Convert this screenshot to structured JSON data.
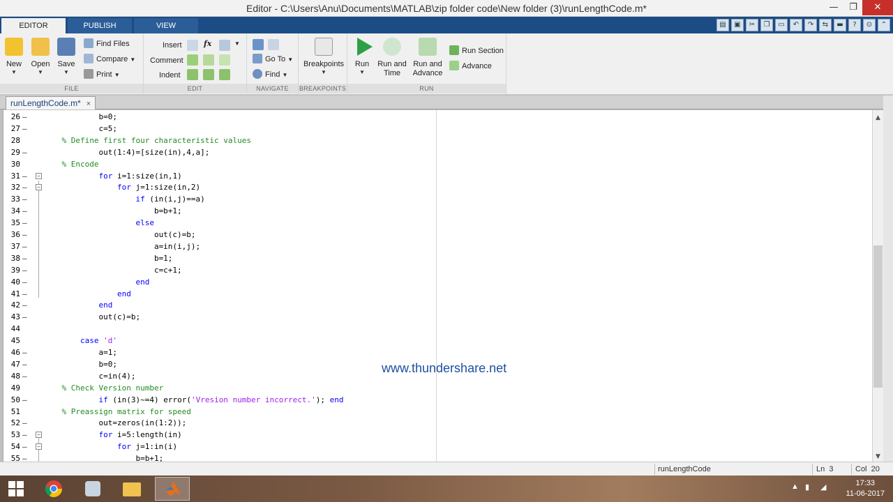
{
  "window": {
    "title": "Editor - C:\\Users\\Anu\\Documents\\MATLAB\\zip folder code\\New folder (3)\\runLengthCode.m*",
    "minimize": "—",
    "restore": "❐",
    "close": "✕"
  },
  "tabs": [
    {
      "label": "EDITOR"
    },
    {
      "label": "PUBLISH"
    },
    {
      "label": "VIEW"
    }
  ],
  "ribbon": {
    "file": {
      "group_label": "FILE",
      "new": "New",
      "open": "Open",
      "save": "Save",
      "find_files": "Find Files",
      "compare": "Compare",
      "print": "Print"
    },
    "edit": {
      "group_label": "EDIT",
      "insert": "Insert",
      "comment": "Comment",
      "indent": "Indent",
      "fx": "fx"
    },
    "navigate": {
      "group_label": "NAVIGATE",
      "goto": "Go To",
      "find": "Find"
    },
    "breakpoints": {
      "group_label": "BREAKPOINTS",
      "breakpoints": "Breakpoints"
    },
    "run": {
      "group_label": "RUN",
      "run": "Run",
      "run_and_time_1": "Run and",
      "run_and_time_2": "Time",
      "run_and_advance_1": "Run and",
      "run_and_advance_2": "Advance",
      "run_section": "Run Section",
      "advance": "Advance"
    },
    "colors": {
      "accent": "#1c4c86",
      "run_green": "#2ea043"
    }
  },
  "file_tab": {
    "name": "runLengthCode.m*",
    "close": "×"
  },
  "code_lines": [
    {
      "num": "26",
      "dash": "—",
      "parts": [
        {
          "t": "            b=0;",
          "c": ""
        }
      ]
    },
    {
      "num": "27",
      "dash": "—",
      "parts": [
        {
          "t": "            c=5;",
          "c": ""
        }
      ]
    },
    {
      "num": "28",
      "dash": "",
      "parts": [
        {
          "t": "    % Define first four characteristic values",
          "c": "cm"
        }
      ]
    },
    {
      "num": "29",
      "dash": "—",
      "parts": [
        {
          "t": "            out(1:4)=[size(in),4,a];",
          "c": ""
        }
      ]
    },
    {
      "num": "30",
      "dash": "",
      "parts": [
        {
          "t": "    % Encode",
          "c": "cm"
        }
      ]
    },
    {
      "num": "31",
      "dash": "—",
      "parts": [
        {
          "t": "            ",
          "c": ""
        },
        {
          "t": "for",
          "c": "kw"
        },
        {
          "t": " i=1:size(in,1)",
          "c": ""
        }
      ]
    },
    {
      "num": "32",
      "dash": "—",
      "parts": [
        {
          "t": "                ",
          "c": ""
        },
        {
          "t": "for",
          "c": "kw"
        },
        {
          "t": " j=1:size(in,2)",
          "c": ""
        }
      ]
    },
    {
      "num": "33",
      "dash": "—",
      "parts": [
        {
          "t": "                    ",
          "c": ""
        },
        {
          "t": "if",
          "c": "kw"
        },
        {
          "t": " (in(i,j)==a)",
          "c": ""
        }
      ]
    },
    {
      "num": "34",
      "dash": "—",
      "parts": [
        {
          "t": "                        b=b+1;",
          "c": ""
        }
      ]
    },
    {
      "num": "35",
      "dash": "—",
      "parts": [
        {
          "t": "                    ",
          "c": ""
        },
        {
          "t": "else",
          "c": "kw"
        }
      ]
    },
    {
      "num": "36",
      "dash": "—",
      "parts": [
        {
          "t": "                        out(c)=b;",
          "c": ""
        }
      ]
    },
    {
      "num": "37",
      "dash": "—",
      "parts": [
        {
          "t": "                        a=in(i,j);",
          "c": ""
        }
      ]
    },
    {
      "num": "38",
      "dash": "—",
      "parts": [
        {
          "t": "                        b=1;",
          "c": ""
        }
      ]
    },
    {
      "num": "39",
      "dash": "—",
      "parts": [
        {
          "t": "                        c=c+1;",
          "c": ""
        }
      ]
    },
    {
      "num": "40",
      "dash": "—",
      "parts": [
        {
          "t": "                    ",
          "c": ""
        },
        {
          "t": "end",
          "c": "kw"
        }
      ]
    },
    {
      "num": "41",
      "dash": "—",
      "parts": [
        {
          "t": "                ",
          "c": ""
        },
        {
          "t": "end",
          "c": "kw"
        }
      ]
    },
    {
      "num": "42",
      "dash": "—",
      "parts": [
        {
          "t": "            ",
          "c": ""
        },
        {
          "t": "end",
          "c": "kw"
        }
      ]
    },
    {
      "num": "43",
      "dash": "—",
      "parts": [
        {
          "t": "            out(c)=b;",
          "c": ""
        }
      ]
    },
    {
      "num": "44",
      "dash": "",
      "parts": [
        {
          "t": "",
          "c": ""
        }
      ]
    },
    {
      "num": "45",
      "dash": "",
      "parts": [
        {
          "t": "        ",
          "c": ""
        },
        {
          "t": "case",
          "c": "kw"
        },
        {
          "t": " ",
          "c": ""
        },
        {
          "t": "'d'",
          "c": "st"
        }
      ]
    },
    {
      "num": "46",
      "dash": "—",
      "parts": [
        {
          "t": "            a=1;",
          "c": ""
        }
      ]
    },
    {
      "num": "47",
      "dash": "—",
      "parts": [
        {
          "t": "            b=0;",
          "c": ""
        }
      ]
    },
    {
      "num": "48",
      "dash": "—",
      "parts": [
        {
          "t": "            c=in(4);",
          "c": ""
        }
      ]
    },
    {
      "num": "49",
      "dash": "",
      "parts": [
        {
          "t": "    % Check Version number",
          "c": "cm"
        }
      ]
    },
    {
      "num": "50",
      "dash": "—",
      "parts": [
        {
          "t": "            ",
          "c": ""
        },
        {
          "t": "if",
          "c": "kw"
        },
        {
          "t": " (in(3)~=4) error(",
          "c": ""
        },
        {
          "t": "'Vresion number incorrect.'",
          "c": "st"
        },
        {
          "t": "); ",
          "c": ""
        },
        {
          "t": "end",
          "c": "kw"
        }
      ]
    },
    {
      "num": "51",
      "dash": "",
      "parts": [
        {
          "t": "    % Preassign matrix for speed",
          "c": "cm"
        }
      ]
    },
    {
      "num": "52",
      "dash": "—",
      "parts": [
        {
          "t": "            out=zeros(in(1:2));",
          "c": ""
        }
      ]
    },
    {
      "num": "53",
      "dash": "—",
      "parts": [
        {
          "t": "            ",
          "c": ""
        },
        {
          "t": "for",
          "c": "kw"
        },
        {
          "t": " i=5:length(in)",
          "c": ""
        }
      ]
    },
    {
      "num": "54",
      "dash": "—",
      "parts": [
        {
          "t": "                ",
          "c": ""
        },
        {
          "t": "for",
          "c": "kw"
        },
        {
          "t": " j=1:in(i)",
          "c": ""
        }
      ]
    },
    {
      "num": "55",
      "dash": "—",
      "parts": [
        {
          "t": "                    b=b+1;",
          "c": ""
        }
      ]
    }
  ],
  "watermark": "www.thundershare.net",
  "status": {
    "file": "runLengthCode",
    "ln_label": "Ln",
    "ln_value": "3",
    "col_label": "Col",
    "col_value": "20"
  },
  "taskbar": {
    "time": "17:33",
    "date": "11-06-2017"
  }
}
